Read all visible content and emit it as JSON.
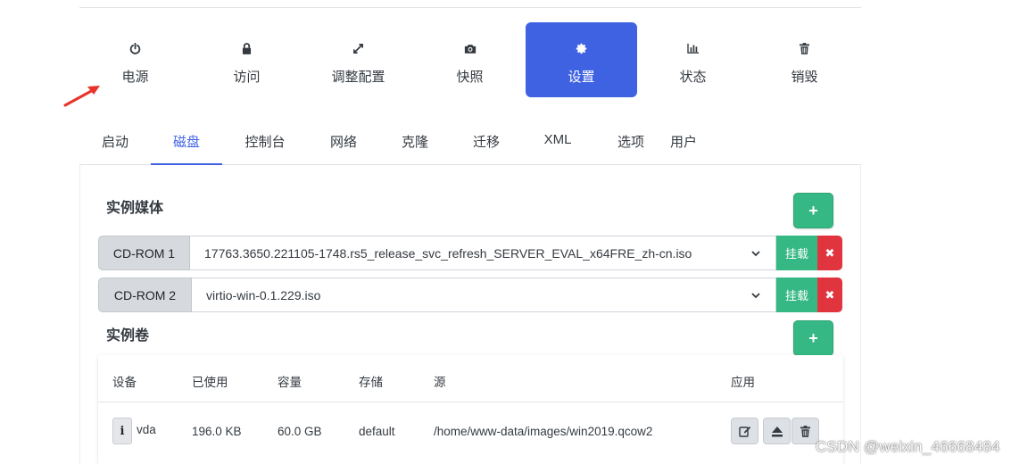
{
  "actions": [
    {
      "label": "电源",
      "icon": "power-icon"
    },
    {
      "label": "访问",
      "icon": "lock-icon"
    },
    {
      "label": "调整配置",
      "icon": "resize-icon"
    },
    {
      "label": "快照",
      "icon": "camera-icon"
    },
    {
      "label": "设置",
      "icon": "gear-icon",
      "active": true
    },
    {
      "label": "状态",
      "icon": "bar-chart-icon"
    },
    {
      "label": "销毁",
      "icon": "trash-icon"
    }
  ],
  "tabs": [
    "启动",
    "磁盘",
    "控制台",
    "网络",
    "克隆",
    "迁移",
    "XML",
    "选项",
    "用户"
  ],
  "active_tab": "磁盘",
  "instance_media": {
    "title": "实例媒体",
    "add_label": "+",
    "rows": [
      {
        "device": "CD-ROM 1",
        "value": "17763.3650.221105-1748.rs5_release_svc_refresh_SERVER_EVAL_x64FRE_zh-cn.iso",
        "mount_label": "挂载",
        "remove_label": "✖"
      },
      {
        "device": "CD-ROM 2",
        "value": "virtio-win-0.1.229.iso",
        "mount_label": "挂载",
        "remove_label": "✖"
      }
    ]
  },
  "instance_volumes": {
    "title": "实例卷",
    "add_label": "+",
    "columns": [
      "设备",
      "已使用",
      "容量",
      "存储",
      "源",
      "应用"
    ],
    "rows": [
      {
        "info_label": "i",
        "device": "vda",
        "used": "196.0 KB",
        "capacity": "60.0 GB",
        "storage": "default",
        "source": "/home/www-data/images/win2019.qcow2"
      }
    ]
  },
  "watermark": "CSDN @weixin_46668484",
  "colors": {
    "accent": "#3f62e3",
    "success": "#35b883",
    "danger": "#e0353f",
    "annotation_arrow": "#e8332a"
  }
}
